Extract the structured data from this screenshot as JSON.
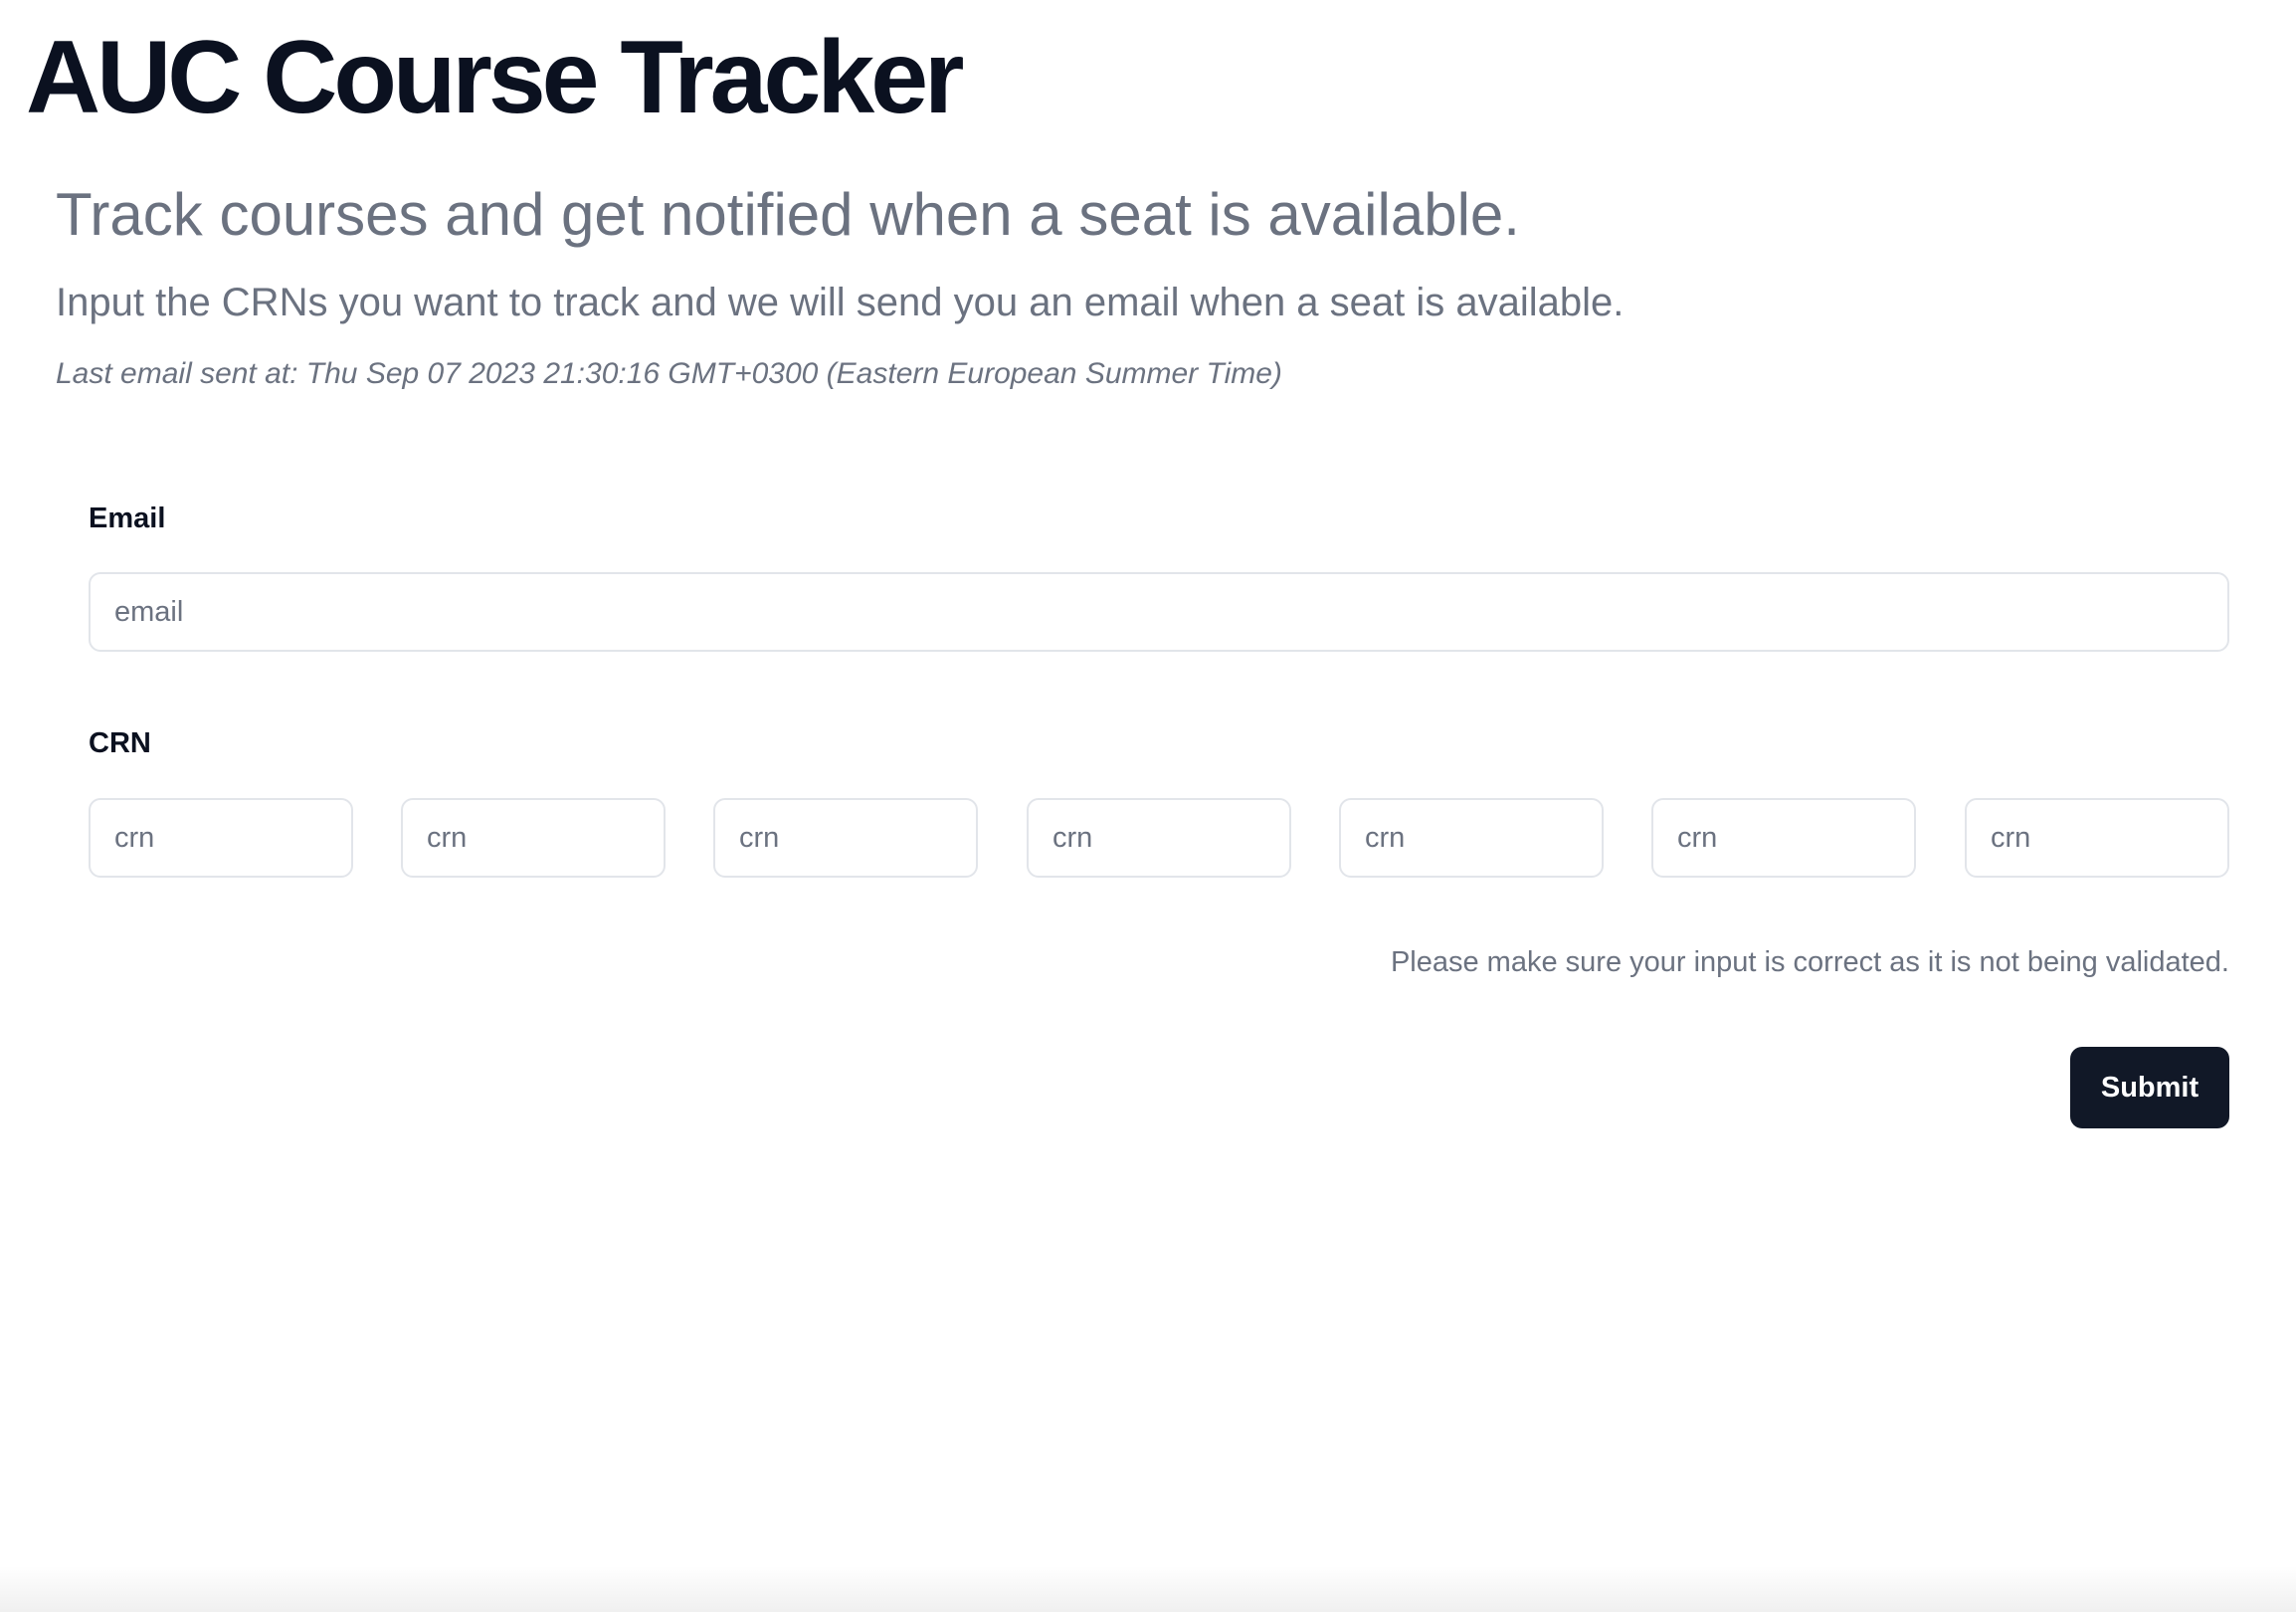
{
  "header": {
    "title": "AUC Course Tracker"
  },
  "intro": {
    "headline": "Track courses and get notified when a seat is available.",
    "description": "Input the CRNs you want to track and we will send you an email when a seat is available.",
    "last_email_sent": "Last email sent at: Thu Sep 07 2023 21:30:16 GMT+0300 (Eastern European Summer Time)"
  },
  "form": {
    "email": {
      "label": "Email",
      "placeholder": "email",
      "value": ""
    },
    "crn": {
      "label": "CRN",
      "fields": [
        {
          "placeholder": "crn",
          "value": ""
        },
        {
          "placeholder": "crn",
          "value": ""
        },
        {
          "placeholder": "crn",
          "value": ""
        },
        {
          "placeholder": "crn",
          "value": ""
        },
        {
          "placeholder": "crn",
          "value": ""
        },
        {
          "placeholder": "crn",
          "value": ""
        },
        {
          "placeholder": "crn",
          "value": ""
        }
      ]
    },
    "note": "Please make sure your input is correct as it is not being validated.",
    "submit_label": "Submit"
  },
  "colors": {
    "primary": "#111827",
    "title": "#0b1120",
    "muted_text": "#6b7280",
    "input_border": "#e2e5ea",
    "background": "#ffffff"
  }
}
